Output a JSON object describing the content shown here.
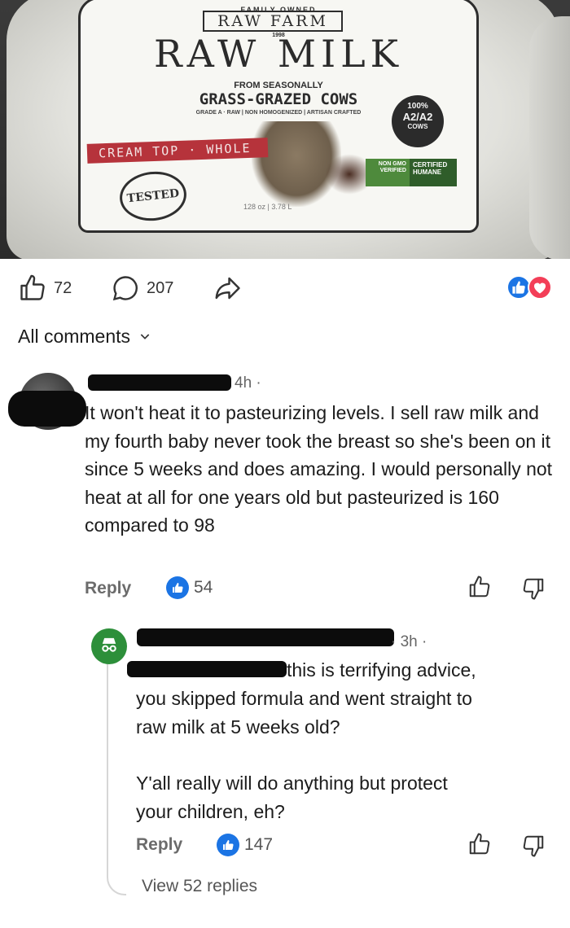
{
  "photo": {
    "family_owned": "FAMILY OWNED",
    "brand": "RAW FARM",
    "brand_year": "1998",
    "title": "RAW MILK",
    "from_line": "FROM SEASONALLY",
    "grass_line": "GRASS-GRAZED COWS",
    "grade_line": "GRADE A · RAW  |  NON HOMOGENIZED  |  ARTISAN CRAFTED",
    "cream_banner": "CREAM TOP · WHOLE",
    "tested_badge": "TESTED",
    "volume": "128 oz | 3.78 L",
    "a2_percent": "100%",
    "a2_text": "A2/A2",
    "a2_cows": "COWS",
    "non_gmo": "NON GMO VERIFIED",
    "certified_humane": "CERTIFIED HUMANE"
  },
  "post_actions": {
    "like_count": "72",
    "comment_count": "207",
    "share_icon": "share-icon",
    "reactions": [
      "like-reaction-icon",
      "love-reaction-icon"
    ],
    "colors": {
      "like": "#1b74e4",
      "love": "#f33e58"
    }
  },
  "comments_header": {
    "label": "All comments"
  },
  "comments": [
    {
      "time": "4h ·",
      "text": "It won't heat it to pasteurizing levels. I sell raw milk and my fourth baby never took the breast so she's been on it since 5 weeks and does amazing. I would personally not heat at all for one years old but pasteurized is 160 compared to 98",
      "reply_label": "Reply",
      "upvotes": "54"
    },
    {
      "time": "· 3h ·",
      "text_line1": "this is terrifying advice,",
      "text_line2": "you skipped formula and went straight to",
      "text_line3": "raw milk at 5 weeks old?",
      "text_line4": "Y'all really will do anything but protect",
      "text_line5": "your children, eh?",
      "reply_label": "Reply",
      "upvotes": "147",
      "avatar_color": "#2d8f3a"
    }
  ],
  "view_replies": "View 52 replies"
}
